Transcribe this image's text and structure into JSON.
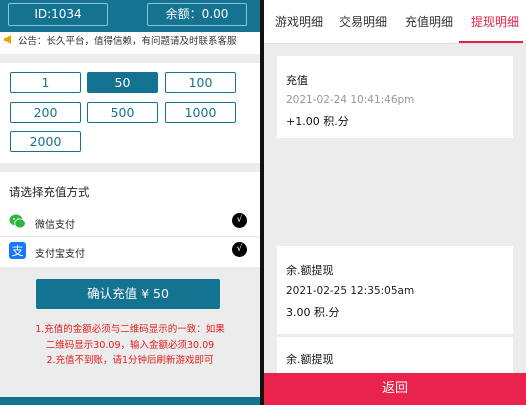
{
  "left": {
    "id_label": "ID:1034",
    "balance_label": "余额：0.00",
    "notice": "公告：长久平台，值得信赖，有问题请及时联系客服",
    "amounts": [
      "1",
      "50",
      "100",
      "200",
      "500",
      "1000",
      "2000"
    ],
    "selected_amount": "50",
    "method_title": "请选择充值方式",
    "methods": [
      {
        "label": "微信支付",
        "icon": "wechat-icon",
        "checked": true
      },
      {
        "label": "支付宝支付",
        "icon": "alipay-icon",
        "checked": true
      }
    ],
    "confirm_label": "确认充值 ¥  50",
    "tips": [
      "1.充值的金额必须与二维码显示的一致：如果",
      "二维码显示30.09，输入金额必须30.09",
      "2.充值不到账，请1分钟后刷新游戏即可"
    ],
    "colors": {
      "primary": "#147391",
      "warning": "#e11b1b"
    }
  },
  "right": {
    "tabs": [
      "游戏明细",
      "交易明细",
      "充值明细",
      "提现明细"
    ],
    "active_tab": "提现明细",
    "records": [
      {
        "title": "充值",
        "time": "2021-02-24 10:41:46pm",
        "value": "+1.00 积.分"
      },
      {
        "title": "余.额提现",
        "time": "2021-02-25 12:35:05am",
        "value": "3.00 积.分"
      },
      {
        "title": "余.额提现",
        "time": "",
        "value": ""
      }
    ],
    "back_label": "返回",
    "colors": {
      "accent": "#e2244a",
      "back_button": "#ea234c"
    }
  }
}
